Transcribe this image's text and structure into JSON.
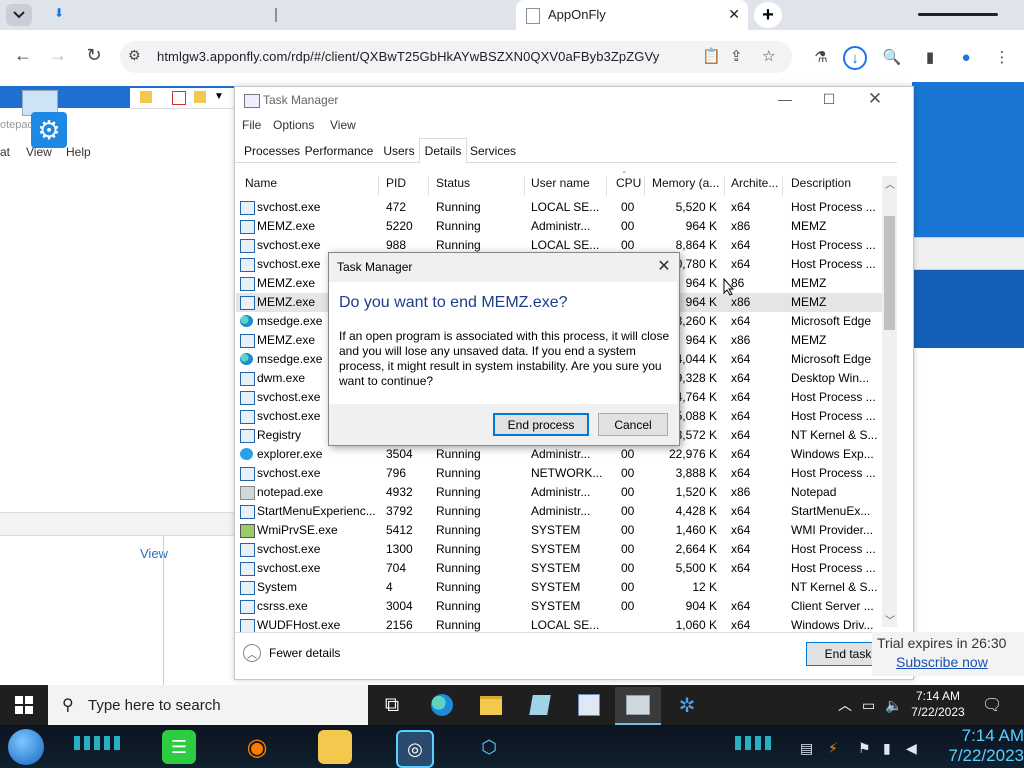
{
  "browser": {
    "active_tab_title": "AppOnFly",
    "url": "htmlgw3.apponfly.com/rdp/#/client/QXBwT25GbHkAYwBSZXN0QXV0aFByb3ZpZGVy"
  },
  "task_manager": {
    "title": "Task Manager",
    "menu": [
      "File",
      "Options",
      "View"
    ],
    "tabs": [
      "Processes",
      "Performance",
      "Users",
      "Details",
      "Services"
    ],
    "active_tab": "Details",
    "columns": [
      "Name",
      "PID",
      "Status",
      "User name",
      "CPU",
      "Memory (a...",
      "Archite...",
      "Description"
    ],
    "rows": [
      {
        "icon": "service-icon",
        "name": "svchost.exe",
        "pid": "472",
        "status": "Running",
        "user": "LOCAL SE...",
        "cpu": "00",
        "mem": "5,520 K",
        "arch": "x64",
        "desc": "Host Process ..."
      },
      {
        "icon": "service-icon",
        "name": "MEMZ.exe",
        "pid": "5220",
        "status": "Running",
        "user": "Administr...",
        "cpu": "00",
        "mem": "964 K",
        "arch": "x86",
        "desc": "MEMZ"
      },
      {
        "icon": "service-icon",
        "name": "svchost.exe",
        "pid": "988",
        "status": "Running",
        "user": "LOCAL SE...",
        "cpu": "00",
        "mem": "8,864 K",
        "arch": "x64",
        "desc": "Host Process ..."
      },
      {
        "icon": "service-icon",
        "name": "svchost.exe",
        "pid": "",
        "status": "",
        "user": "",
        "cpu": "",
        "mem": "0,780 K",
        "arch": "x64",
        "desc": "Host Process ..."
      },
      {
        "icon": "service-icon",
        "name": "MEMZ.exe",
        "pid": "",
        "status": "",
        "user": "",
        "cpu": "",
        "mem": "964 K",
        "arch": "86",
        "desc": "MEMZ"
      },
      {
        "icon": "service-icon",
        "name": "MEMZ.exe",
        "pid": "",
        "status": "",
        "user": "",
        "cpu": "",
        "mem": "964 K",
        "arch": "x86",
        "desc": "MEMZ",
        "selected": true
      },
      {
        "icon": "edge-icon",
        "name": "msedge.exe",
        "pid": "",
        "status": "",
        "user": "",
        "cpu": "",
        "mem": "8,260 K",
        "arch": "x64",
        "desc": "Microsoft Edge"
      },
      {
        "icon": "service-icon",
        "name": "MEMZ.exe",
        "pid": "",
        "status": "",
        "user": "",
        "cpu": "",
        "mem": "964 K",
        "arch": "x86",
        "desc": "MEMZ"
      },
      {
        "icon": "edge-icon",
        "name": "msedge.exe",
        "pid": "",
        "status": "",
        "user": "",
        "cpu": "",
        "mem": "4,044 K",
        "arch": "x64",
        "desc": "Microsoft Edge"
      },
      {
        "icon": "service-icon",
        "name": "dwm.exe",
        "pid": "",
        "status": "",
        "user": "",
        "cpu": "",
        "mem": "9,328 K",
        "arch": "x64",
        "desc": "Desktop Win..."
      },
      {
        "icon": "service-icon",
        "name": "svchost.exe",
        "pid": "",
        "status": "",
        "user": "",
        "cpu": "",
        "mem": "4,764 K",
        "arch": "x64",
        "desc": "Host Process ..."
      },
      {
        "icon": "service-icon",
        "name": "svchost.exe",
        "pid": "",
        "status": "",
        "user": "",
        "cpu": "",
        "mem": "5,088 K",
        "arch": "x64",
        "desc": "Host Process ..."
      },
      {
        "icon": "service-icon",
        "name": "Registry",
        "pid": "",
        "status": "",
        "user": "",
        "cpu": "",
        "mem": "8,572 K",
        "arch": "x64",
        "desc": "NT Kernel & S..."
      },
      {
        "icon": "explorer-icon",
        "name": "explorer.exe",
        "pid": "3504",
        "status": "Running",
        "user": "Administr...",
        "cpu": "00",
        "mem": "22,976 K",
        "arch": "x64",
        "desc": "Windows Exp..."
      },
      {
        "icon": "service-icon",
        "name": "svchost.exe",
        "pid": "796",
        "status": "Running",
        "user": "NETWORK...",
        "cpu": "00",
        "mem": "3,888 K",
        "arch": "x64",
        "desc": "Host Process ..."
      },
      {
        "icon": "notepad-icon",
        "name": "notepad.exe",
        "pid": "4932",
        "status": "Running",
        "user": "Administr...",
        "cpu": "00",
        "mem": "1,520 K",
        "arch": "x86",
        "desc": "Notepad"
      },
      {
        "icon": "service-icon",
        "name": "StartMenuExperienc...",
        "pid": "3792",
        "status": "Running",
        "user": "Administr...",
        "cpu": "00",
        "mem": "4,428 K",
        "arch": "x64",
        "desc": "StartMenuEx..."
      },
      {
        "icon": "wmi-icon",
        "name": "WmiPrvSE.exe",
        "pid": "5412",
        "status": "Running",
        "user": "SYSTEM",
        "cpu": "00",
        "mem": "1,460 K",
        "arch": "x64",
        "desc": "WMI Provider..."
      },
      {
        "icon": "service-icon",
        "name": "svchost.exe",
        "pid": "1300",
        "status": "Running",
        "user": "SYSTEM",
        "cpu": "00",
        "mem": "2,664 K",
        "arch": "x64",
        "desc": "Host Process ..."
      },
      {
        "icon": "service-icon",
        "name": "svchost.exe",
        "pid": "704",
        "status": "Running",
        "user": "SYSTEM",
        "cpu": "00",
        "mem": "5,500 K",
        "arch": "x64",
        "desc": "Host Process ..."
      },
      {
        "icon": "service-icon",
        "name": "System",
        "pid": "4",
        "status": "Running",
        "user": "SYSTEM",
        "cpu": "00",
        "mem": "12 K",
        "arch": "",
        "desc": "NT Kernel & S..."
      },
      {
        "icon": "service-icon",
        "name": "csrss.exe",
        "pid": "3004",
        "status": "Running",
        "user": "SYSTEM",
        "cpu": "00",
        "mem": "904 K",
        "arch": "x64",
        "desc": "Client Server ..."
      },
      {
        "icon": "service-icon",
        "name": "WUDFHost.exe",
        "pid": "2156",
        "status": "Running",
        "user": "LOCAL SE...",
        "cpu": "",
        "mem": "1,060 K",
        "arch": "x64",
        "desc": "Windows Driv..."
      }
    ],
    "fewer_details": "Fewer details",
    "end_task": "End task"
  },
  "dialog": {
    "title": "Task Manager",
    "heading": "Do you want to end MEMZ.exe?",
    "body": "If an open program is associated with this process, it will close and you will lose any unsaved data. If you end a system process, it might result in system instability. Are you sure you want to continue?",
    "confirm": "End process",
    "cancel": "Cancel"
  },
  "background_window": {
    "side_label": "otepad",
    "menu_partial": [
      "at",
      "View",
      "Help"
    ],
    "view_link": "View"
  },
  "trial": {
    "text": "Trial expires in 26:30",
    "link": "Subscribe now"
  },
  "windows_taskbar": {
    "search_placeholder": "Type here to search",
    "time": "7:14 AM",
    "date": "7/22/2023"
  },
  "host_panel": {
    "time": "7:14 AM",
    "date": "7/22/2023"
  },
  "colors": {
    "accent": "#0078d7",
    "dialog_heading": "#1c3e8c",
    "desktop_blue": "#1976d2"
  }
}
